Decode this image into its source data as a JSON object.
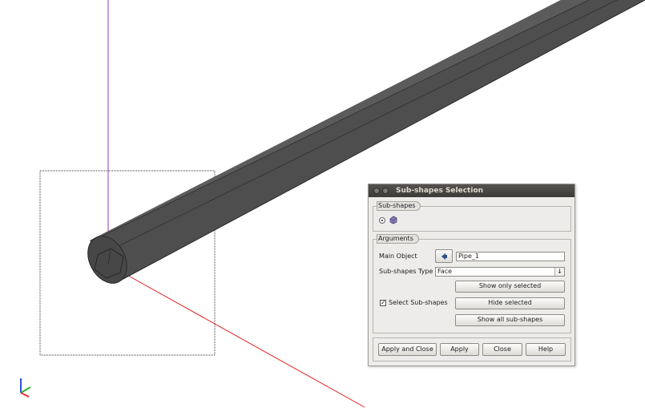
{
  "dialog": {
    "title": "Sub-shapes Selection",
    "subshapes_group": {
      "title": "Sub-shapes"
    },
    "arguments_group": {
      "title": "Arguments",
      "main_object_label": "Main Object",
      "main_object_value": "Pipe_1",
      "subshapes_type_label": "Sub-shapes Type",
      "subshapes_type_value": "Face",
      "select_subshapes_label": "Select Sub-shapes",
      "select_subshapes_checked": true,
      "check_mark": "✓",
      "combo_arrow": "↓",
      "show_only_selected": "Show only selected",
      "hide_selected": "Hide selected",
      "show_all_subshapes": "Show all sub-shapes"
    },
    "footer": {
      "apply_and_close": "Apply and Close",
      "apply": "Apply",
      "close": "Close",
      "help": "Help"
    }
  },
  "colors": {
    "axis_x": "#e02020",
    "axis_z": "#8a38b8",
    "pipe_body": "#4e4e4e",
    "pipe_highlight": "#6a6a6a",
    "titlebar": "#3c3b37",
    "dialog_bg": "#edeceb"
  },
  "icons": {
    "radio_shape_icon": "solid-shape-icon",
    "selection_button_icon": "arrow-select-icon",
    "trihedron": "axis-trihedron-icon"
  }
}
